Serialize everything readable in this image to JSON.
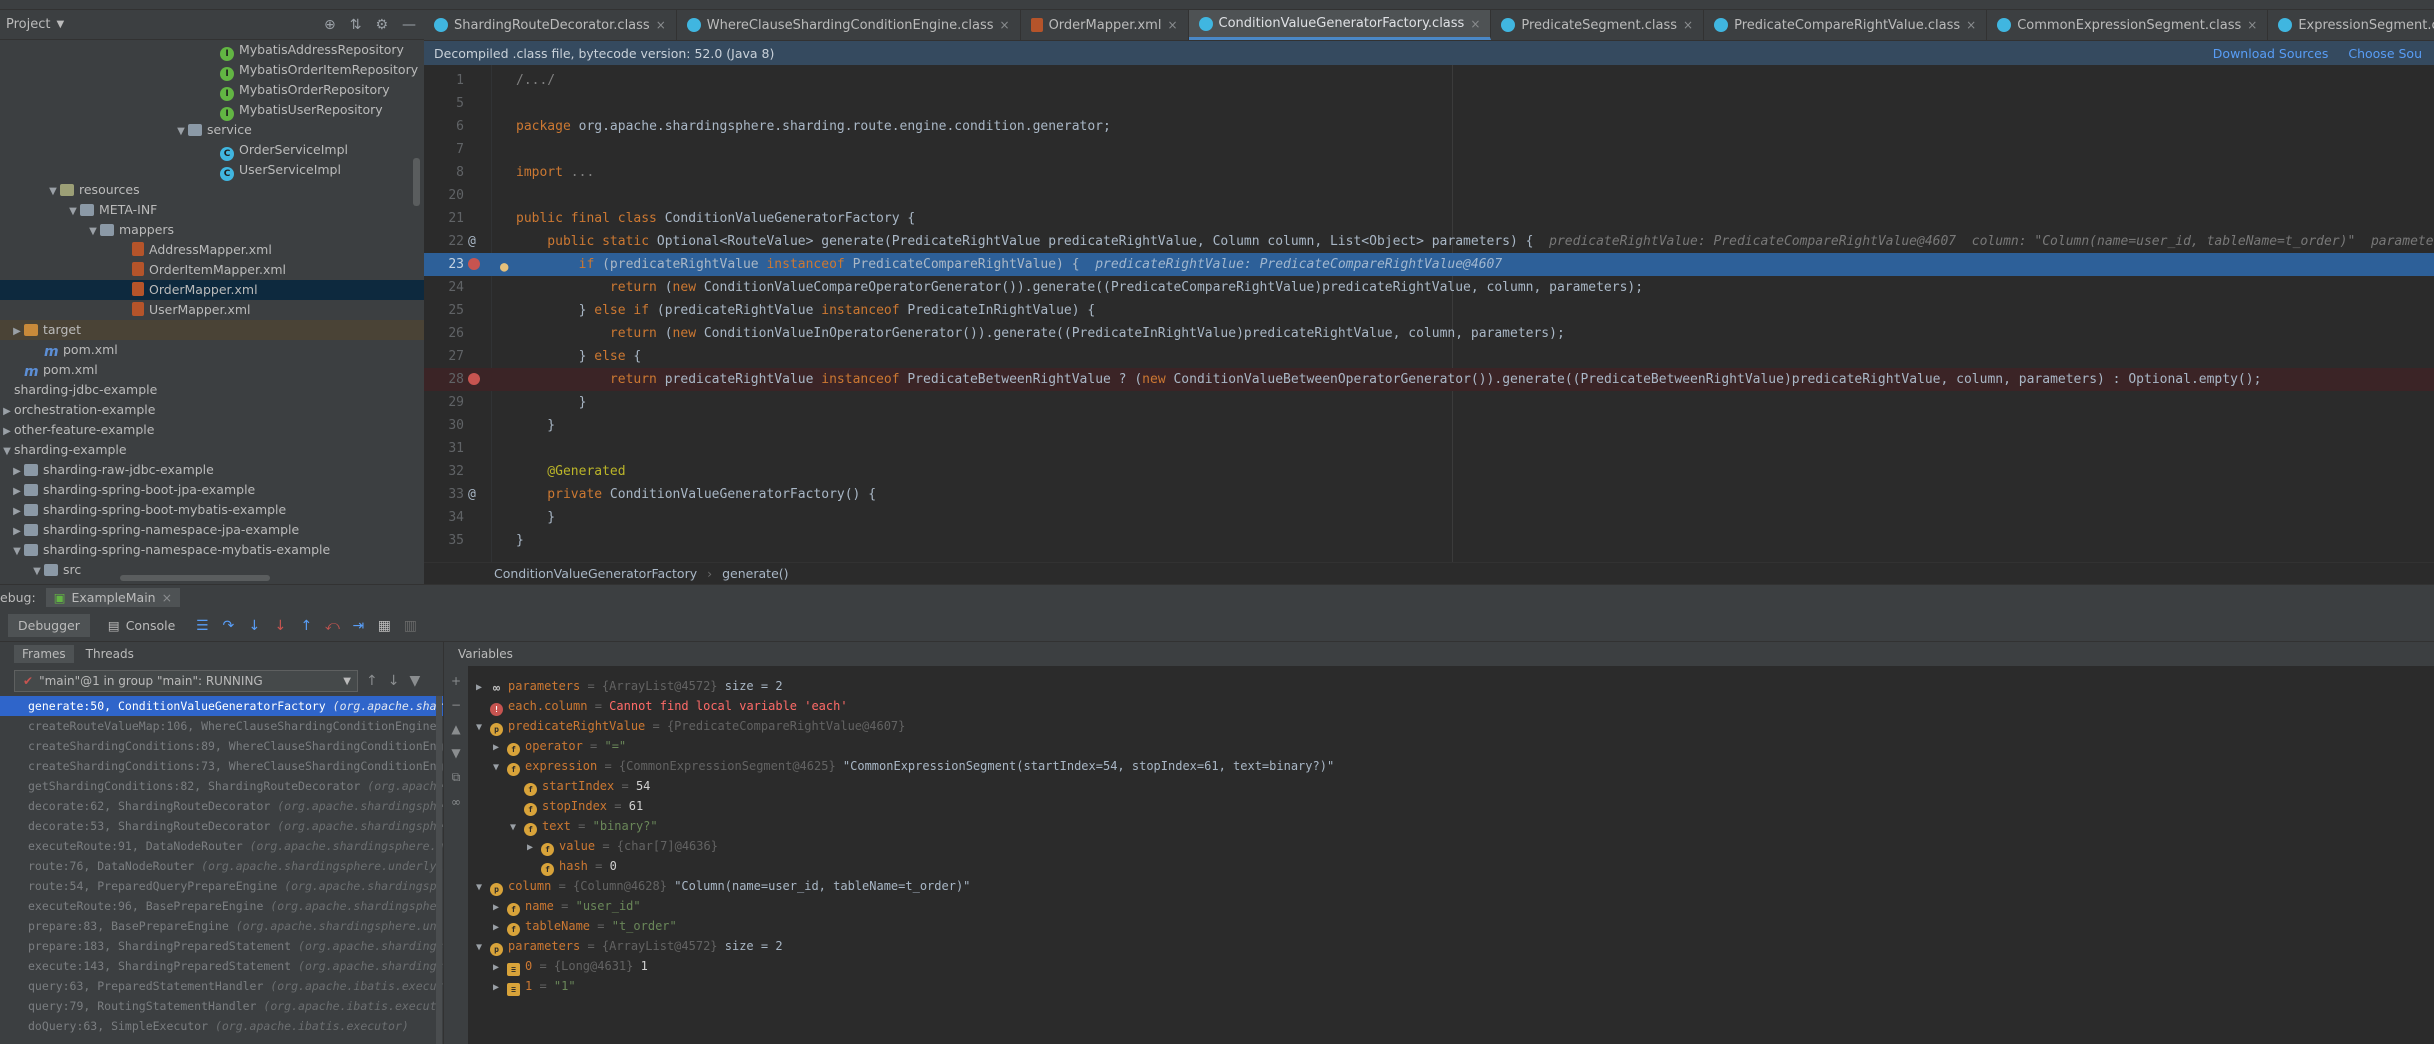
{
  "project": {
    "header_label": "Project",
    "tree": [
      {
        "label": "MybatisAddressRepository",
        "indent": 220,
        "icon": "green",
        "kind": "interface"
      },
      {
        "label": "MybatisOrderItemRepository",
        "indent": 220,
        "icon": "green",
        "kind": "interface"
      },
      {
        "label": "MybatisOrderRepository",
        "indent": 220,
        "icon": "green",
        "kind": "interface"
      },
      {
        "label": "MybatisUserRepository",
        "indent": 220,
        "icon": "green",
        "kind": "interface"
      },
      {
        "label": "service",
        "indent": 188,
        "icon": "folder",
        "toggle": "down"
      },
      {
        "label": "OrderServiceImpl",
        "indent": 220,
        "icon": "blue",
        "kind": "class"
      },
      {
        "label": "UserServiceImpl",
        "indent": 220,
        "icon": "blue",
        "kind": "class"
      },
      {
        "label": "resources",
        "indent": 60,
        "icon": "folder res",
        "toggle": "down"
      },
      {
        "label": "META-INF",
        "indent": 80,
        "icon": "folder",
        "toggle": "down"
      },
      {
        "label": "mappers",
        "indent": 100,
        "icon": "folder",
        "toggle": "down"
      },
      {
        "label": "AddressMapper.xml",
        "indent": 132,
        "icon": "xml"
      },
      {
        "label": "OrderItemMapper.xml",
        "indent": 132,
        "icon": "xml"
      },
      {
        "label": "OrderMapper.xml",
        "indent": 132,
        "icon": "xml",
        "state": "sel"
      },
      {
        "label": "UserMapper.xml",
        "indent": 132,
        "icon": "xml"
      },
      {
        "label": "target",
        "indent": 24,
        "icon": "folder orange",
        "toggle": "right",
        "state": "hl"
      },
      {
        "label": "pom.xml",
        "indent": 44,
        "icon": "m"
      },
      {
        "label": "pom.xml",
        "indent": 24,
        "icon": "m"
      },
      {
        "label": "sharding-jdbc-example",
        "indent": 6,
        "icon": "none"
      },
      {
        "label": "orchestration-example",
        "indent": 6,
        "icon": "none",
        "toggle": "right"
      },
      {
        "label": "other-feature-example",
        "indent": 6,
        "icon": "none",
        "toggle": "right"
      },
      {
        "label": "sharding-example",
        "indent": 6,
        "icon": "none",
        "toggle": "down"
      },
      {
        "label": "sharding-raw-jdbc-example",
        "indent": 24,
        "icon": "folder",
        "toggle": "right"
      },
      {
        "label": "sharding-spring-boot-jpa-example",
        "indent": 24,
        "icon": "folder",
        "toggle": "right"
      },
      {
        "label": "sharding-spring-boot-mybatis-example",
        "indent": 24,
        "icon": "folder",
        "toggle": "right"
      },
      {
        "label": "sharding-spring-namespace-jpa-example",
        "indent": 24,
        "icon": "folder",
        "toggle": "right"
      },
      {
        "label": "sharding-spring-namespace-mybatis-example",
        "indent": 24,
        "icon": "folder",
        "toggle": "down"
      },
      {
        "label": "src",
        "indent": 44,
        "icon": "folder",
        "toggle": "down"
      }
    ]
  },
  "tabs": [
    {
      "label": "ShardingRouteDecorator.class",
      "icon": "cls"
    },
    {
      "label": "WhereClauseShardingConditionEngine.class",
      "icon": "cls"
    },
    {
      "label": "OrderMapper.xml",
      "icon": "xml"
    },
    {
      "label": "ConditionValueGeneratorFactory.class",
      "icon": "cls",
      "active": true
    },
    {
      "label": "PredicateSegment.class",
      "icon": "cls"
    },
    {
      "label": "PredicateCompareRightValue.class",
      "icon": "cls"
    },
    {
      "label": "CommonExpressionSegment.class",
      "icon": "cls"
    },
    {
      "label": "ExpressionSegment.class",
      "icon": "cls"
    }
  ],
  "banner": {
    "text": "Decompiled .class file, bytecode version: 52.0 (Java 8)",
    "download_sources": "Download Sources",
    "choose_sources": "Choose Sou"
  },
  "editor": {
    "lines": [
      {
        "num": "1",
        "gutter": "",
        "segments": [
          {
            "t": "/.../",
            "c": "cm"
          }
        ]
      },
      {
        "num": "5",
        "gutter": "",
        "segments": []
      },
      {
        "num": "6",
        "gutter": "",
        "segments": [
          {
            "t": "package ",
            "c": "kw"
          },
          {
            "t": "org.apache.shardingsphere.sharding.route.engine.condition.generator;",
            "c": ""
          }
        ]
      },
      {
        "num": "7",
        "gutter": "",
        "segments": []
      },
      {
        "num": "8",
        "gutter": "",
        "segments": [
          {
            "t": "import ",
            "c": "kw"
          },
          {
            "t": "...",
            "c": "cm"
          }
        ]
      },
      {
        "num": "20",
        "gutter": "",
        "segments": []
      },
      {
        "num": "21",
        "gutter": "",
        "segments": [
          {
            "t": "public final class ",
            "c": "kw"
          },
          {
            "t": "ConditionValueGeneratorFactory {",
            "c": ""
          }
        ]
      },
      {
        "num": "22",
        "gutter": "@",
        "segments": [
          {
            "t": "    public static ",
            "c": "kw"
          },
          {
            "t": "Optional<RouteValue> generate(PredicateRightValue predicateRightValue, Column column, List<Object> parameters) {  ",
            "c": ""
          },
          {
            "t": "predicateRightValue: PredicateCompareRightValue@4607  column: \"Column(name=user_id, tableName=t_order)\"  parameters:",
            "c": "inline-hint"
          }
        ]
      },
      {
        "num": "23",
        "gutter": "bp",
        "state": "exec",
        "segments": [
          {
            "t": "        if ",
            "c": "kw"
          },
          {
            "t": "(predicateRightValue ",
            "c": ""
          },
          {
            "t": "instanceof ",
            "c": "kw"
          },
          {
            "t": "PredicateCompareRightValue) {  ",
            "c": ""
          },
          {
            "t": "predicateRightValue: PredicateCompareRightValue@4607",
            "c": "inline-hint"
          }
        ]
      },
      {
        "num": "24",
        "gutter": "",
        "segments": [
          {
            "t": "            return ",
            "c": "kw"
          },
          {
            "t": "(",
            "c": ""
          },
          {
            "t": "new ",
            "c": "kw"
          },
          {
            "t": "ConditionValueCompareOperatorGenerator()).generate((PredicateCompareRightValue)predicateRightValue, column, parameters);",
            "c": ""
          }
        ]
      },
      {
        "num": "25",
        "gutter": "",
        "segments": [
          {
            "t": "        } ",
            "c": ""
          },
          {
            "t": "else if ",
            "c": "kw"
          },
          {
            "t": "(predicateRightValue ",
            "c": ""
          },
          {
            "t": "instanceof ",
            "c": "kw"
          },
          {
            "t": "PredicateInRightValue) {",
            "c": ""
          }
        ]
      },
      {
        "num": "26",
        "gutter": "",
        "segments": [
          {
            "t": "            return ",
            "c": "kw"
          },
          {
            "t": "(",
            "c": ""
          },
          {
            "t": "new ",
            "c": "kw"
          },
          {
            "t": "ConditionValueInOperatorGenerator()).generate((PredicateInRightValue)predicateRightValue, column, parameters);",
            "c": ""
          }
        ]
      },
      {
        "num": "27",
        "gutter": "",
        "segments": [
          {
            "t": "        } ",
            "c": ""
          },
          {
            "t": "else ",
            "c": "kw"
          },
          {
            "t": "{",
            "c": ""
          }
        ]
      },
      {
        "num": "28",
        "gutter": "bp",
        "state": "bp",
        "segments": [
          {
            "t": "            return ",
            "c": "kw"
          },
          {
            "t": "predicateRightValue ",
            "c": ""
          },
          {
            "t": "instanceof ",
            "c": "kw"
          },
          {
            "t": "PredicateBetweenRightValue ? (",
            "c": ""
          },
          {
            "t": "new ",
            "c": "kw"
          },
          {
            "t": "ConditionValueBetweenOperatorGenerator()).generate((PredicateBetweenRightValue)predicateRightValue, column, parameters) : Optional.empty();",
            "c": ""
          }
        ]
      },
      {
        "num": "29",
        "gutter": "",
        "segments": [
          {
            "t": "        }",
            "c": ""
          }
        ]
      },
      {
        "num": "30",
        "gutter": "",
        "segments": [
          {
            "t": "    }",
            "c": ""
          }
        ]
      },
      {
        "num": "31",
        "gutter": "",
        "segments": []
      },
      {
        "num": "32",
        "gutter": "",
        "segments": [
          {
            "t": "    @Generated",
            "c": "ann"
          }
        ]
      },
      {
        "num": "33",
        "gutter": "@",
        "segments": [
          {
            "t": "    private ",
            "c": "kw"
          },
          {
            "t": "ConditionValueGeneratorFactory() {",
            "c": ""
          }
        ]
      },
      {
        "num": "34",
        "gutter": "",
        "segments": [
          {
            "t": "    }",
            "c": ""
          }
        ]
      },
      {
        "num": "35",
        "gutter": "",
        "segments": [
          {
            "t": "}",
            "c": ""
          }
        ]
      }
    ]
  },
  "breadcrumb": {
    "class_name": "ConditionValueGeneratorFactory",
    "method": "generate()"
  },
  "debug": {
    "title": "ebug:",
    "run_tab": "ExampleMain",
    "debugger_tab": "Debugger",
    "console_tab": "Console",
    "frames_tab": "Frames",
    "threads_tab": "Threads",
    "thread_select": "\"main\"@1 in group \"main\": RUNNING",
    "variables_header": "Variables",
    "frames": [
      {
        "method": "generate:50, ConditionValueGeneratorFactory ",
        "pkg": "(org.apache.shar",
        "sel": true
      },
      {
        "method": "createRouteValueMap:106, WhereClauseShardingConditionEngine",
        "pkg": ""
      },
      {
        "method": "createShardingConditions:89, WhereClauseShardingConditionEngine",
        "pkg": ""
      },
      {
        "method": "createShardingConditions:73, WhereClauseShardingConditionEngine",
        "pkg": ""
      },
      {
        "method": "getShardingConditions:82, ShardingRouteDecorator ",
        "pkg": "(org.apache"
      },
      {
        "method": "decorate:62, ShardingRouteDecorator ",
        "pkg": "(org.apache.shardingsphe"
      },
      {
        "method": "decorate:53, ShardingRouteDecorator ",
        "pkg": "(org.apache.shardingsphe"
      },
      {
        "method": "executeRoute:91, DataNodeRouter ",
        "pkg": "(org.apache.shardingsphere.u"
      },
      {
        "method": "route:76, DataNodeRouter ",
        "pkg": "(org.apache.shardingsphere.underlyi"
      },
      {
        "method": "route:54, PreparedQueryPrepareEngine ",
        "pkg": "(org.apache.shardingsp"
      },
      {
        "method": "executeRoute:96, BasePrepareEngine ",
        "pkg": "(org.apache.shardingsphe"
      },
      {
        "method": "prepare:83, BasePrepareEngine ",
        "pkg": "(org.apache.shardingsphere.un"
      },
      {
        "method": "prepare:183, ShardingPreparedStatement ",
        "pkg": "(org.apache.shardings"
      },
      {
        "method": "execute:143, ShardingPreparedStatement ",
        "pkg": "(org.apache.shardings"
      },
      {
        "method": "query:63, PreparedStatementHandler ",
        "pkg": "(org.apache.ibatis.execut"
      },
      {
        "method": "query:79, RoutingStatementHandler ",
        "pkg": "(org.apache.ibatis.execut"
      },
      {
        "method": "doQuery:63, SimpleExecutor ",
        "pkg": "(org.apache.ibatis.executor)"
      }
    ],
    "variables": [
      {
        "indent": 0,
        "arrow": "right",
        "icon": "oo",
        "name": "parameters",
        "ref": " = {ArrayList@4572} ",
        "value": " size = 2",
        "vc": "vplain"
      },
      {
        "indent": 0,
        "arrow": "",
        "icon": "err",
        "name": "each.column",
        "ref": " = ",
        "value": "Cannot find local variable 'each'",
        "vc": "verr"
      },
      {
        "indent": 0,
        "arrow": "down",
        "icon": "p",
        "name": "predicateRightValue",
        "ref": " = {PredicateCompareRightValue@4607}",
        "value": "",
        "vc": "vplain"
      },
      {
        "indent": 1,
        "arrow": "right",
        "icon": "f",
        "name": "operator",
        "ref": " = ",
        "value": "\"=\"",
        "vc": "vstr"
      },
      {
        "indent": 1,
        "arrow": "down",
        "icon": "f",
        "name": "expression",
        "ref": " = {CommonExpressionSegment@4625} ",
        "value": "\"CommonExpressionSegment(startIndex=54, stopIndex=61, text=binary?)\"",
        "vc": "vplain"
      },
      {
        "indent": 2,
        "arrow": "",
        "icon": "f",
        "name": "startIndex",
        "ref": " = ",
        "value": "54",
        "vc": "vnum"
      },
      {
        "indent": 2,
        "arrow": "",
        "icon": "f",
        "name": "stopIndex",
        "ref": " = ",
        "value": "61",
        "vc": "vnum"
      },
      {
        "indent": 2,
        "arrow": "down",
        "icon": "f",
        "name": "text",
        "ref": " = ",
        "value": "\"binary?\"",
        "vc": "vstr"
      },
      {
        "indent": 3,
        "arrow": "right",
        "icon": "f",
        "name": "value",
        "ref": " = {char[7]@4636}",
        "value": "",
        "vc": "vplain"
      },
      {
        "indent": 3,
        "arrow": "",
        "icon": "f",
        "name": "hash",
        "ref": " = ",
        "value": "0",
        "vc": "vnum"
      },
      {
        "indent": 0,
        "arrow": "down",
        "icon": "p",
        "name": "column",
        "ref": " = {Column@4628} ",
        "value": "\"Column(name=user_id, tableName=t_order)\"",
        "vc": "vplain"
      },
      {
        "indent": 1,
        "arrow": "right",
        "icon": "f",
        "name": "name",
        "ref": " = ",
        "value": "\"user_id\"",
        "vc": "vstr"
      },
      {
        "indent": 1,
        "arrow": "right",
        "icon": "f",
        "name": "tableName",
        "ref": " = ",
        "value": "\"t_order\"",
        "vc": "vstr"
      },
      {
        "indent": 0,
        "arrow": "down",
        "icon": "p",
        "name": "parameters",
        "ref": " = {ArrayList@4572} ",
        "value": " size = 2",
        "vc": "vplain"
      },
      {
        "indent": 1,
        "arrow": "right",
        "icon": "arr",
        "name": "0",
        "ref": " = {Long@4631} ",
        "value": "1",
        "vc": "vnum"
      },
      {
        "indent": 1,
        "arrow": "right",
        "icon": "arr",
        "name": "1",
        "ref": " = ",
        "value": "\"1\"",
        "vc": "vstr"
      }
    ]
  },
  "colors": {
    "exec_line": "#2d6099",
    "breakpoint": "#c75450",
    "selection": "#2f65ca",
    "accent": "#4a88c7"
  }
}
